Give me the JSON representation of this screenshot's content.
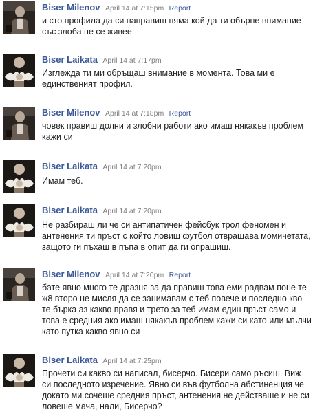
{
  "comments": [
    {
      "author": "Biser Milenov",
      "time": "April 14 at 7:15pm",
      "report": "Report",
      "text": "и сто профила да си направиш няма кой да ти обърне внимание със злоба не се живее"
    },
    {
      "author": "Biser Laikata",
      "time": "April 14 at 7:17pm",
      "report": "",
      "text": "Изглежда ти ми обръщаш внимание в момента. Това ми е единственият профил."
    },
    {
      "author": "Biser Milenov",
      "time": "April 14 at 7:18pm",
      "report": "Report",
      "text": "човек правиш долни и злобни работи ако имаш някакъв проблем кажи си"
    },
    {
      "author": "Biser Laikata",
      "time": "April 14 at 7:20pm",
      "report": "",
      "text": "Имам теб."
    },
    {
      "author": "Biser Laikata",
      "time": "April 14 at 7:20pm",
      "report": "",
      "text": "Не разбираш ли че си антипатичен фейсбук трол феномен и антенения ти пръст с който ловиш футбол отвращава момичетата, защото ги пъхаш в пъпа в опит да ги опрашиш."
    },
    {
      "author": "Biser Milenov",
      "time": "April 14 at 7:20pm",
      "report": "Report",
      "text": "бате явно много те дразня за да правиш това еми радвам поне те ж8 второ не мисля да се занимавам с теб повече и последно кво те бърка аз какво правя и трето за теб имам един пръст само и това е средния ако имаш някакъв проблем кажи си като или мълчи като путка какво явно си"
    },
    {
      "author": "Biser Laikata",
      "time": "April 14 at 7:25pm",
      "report": "",
      "text": "Прочети си какво си написал, бисерчо. Бисери само ръсиш. Виж си последното изречение. Явно си във футболна абстиненция че докато ми сочеше средния пръст, антенения не действаше и не си ловеше мача, нали, Бисерчо?"
    }
  ]
}
